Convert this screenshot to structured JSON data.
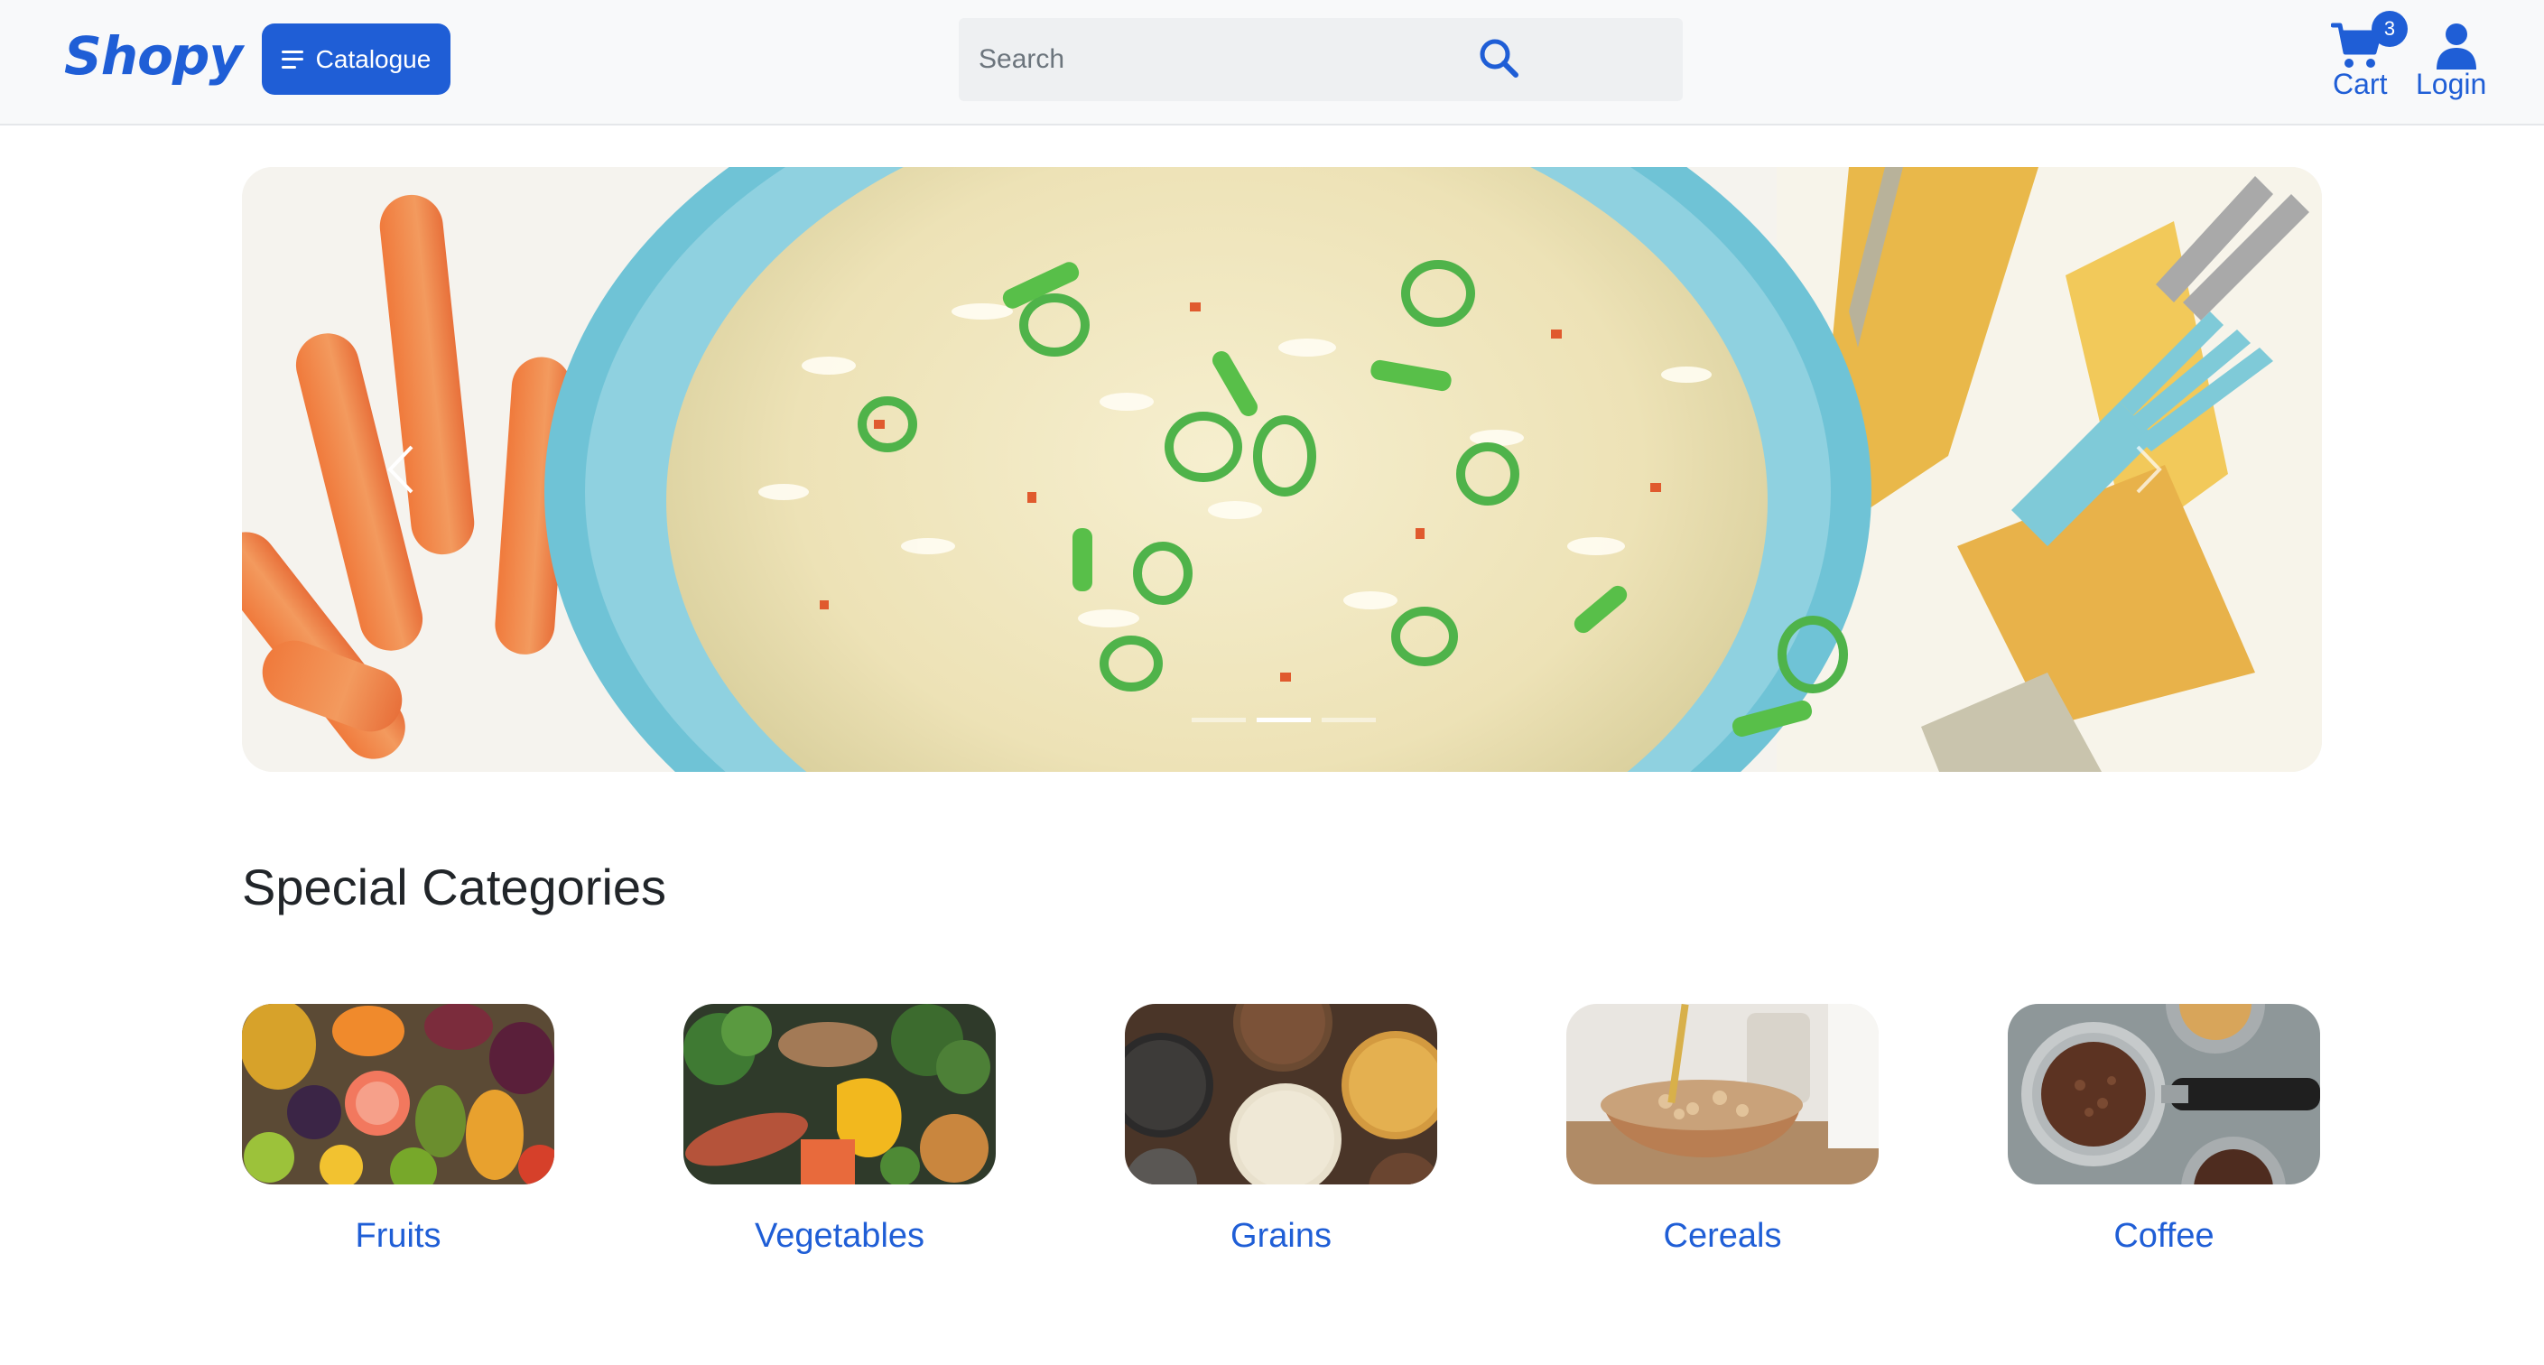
{
  "navbar": {
    "brand": "Shopy",
    "catalogue_label": "Catalogue",
    "search_placeholder": "Search",
    "search_value": "",
    "cart_label": "Cart",
    "cart_count": "3",
    "login_label": "Login"
  },
  "carousel": {
    "slide_count": 3,
    "active_slide": 2
  },
  "categories": {
    "title": "Special Categories",
    "items": [
      {
        "label": "Fruits"
      },
      {
        "label": "Vegetables"
      },
      {
        "label": "Grains"
      },
      {
        "label": "Cereals"
      },
      {
        "label": "Coffee"
      }
    ]
  },
  "colors": {
    "accent": "#1f5ed6",
    "navbar_bg": "#f8f9fa",
    "search_bg": "#eef0f2"
  },
  "icons": [
    "hamburger-icon",
    "search-icon",
    "cart-icon",
    "user-icon",
    "chevron-left-icon",
    "chevron-right-icon"
  ]
}
